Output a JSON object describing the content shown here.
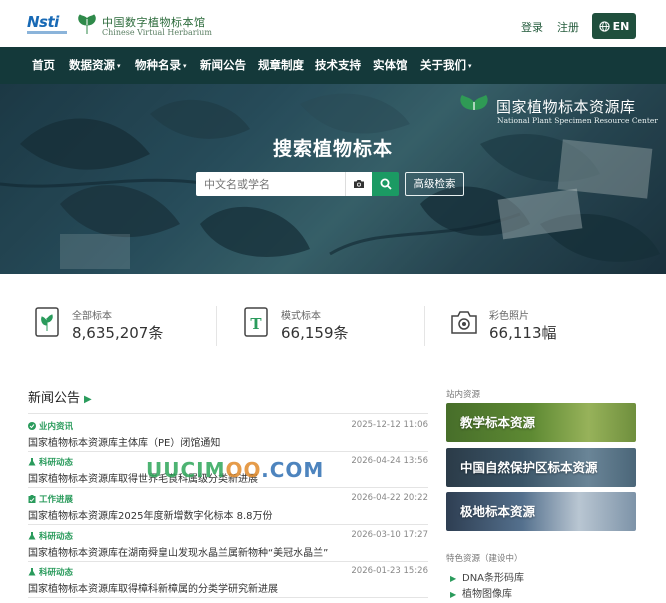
{
  "header": {
    "logo_text": "Nsti",
    "site_name_cn": "中国数字植物标本馆",
    "site_name_en": "Chinese Virtual Herbarium",
    "login": "登录",
    "register": "注册",
    "language": "EN",
    "accent_color": "#1f4f3d"
  },
  "nav": {
    "items": [
      {
        "label": "首页",
        "dropdown": false
      },
      {
        "label": "数据资源",
        "dropdown": true
      },
      {
        "label": "物种名录",
        "dropdown": true
      },
      {
        "label": "新闻公告",
        "dropdown": false
      },
      {
        "label": "规章制度",
        "dropdown": false
      },
      {
        "label": "技术支持",
        "dropdown": false
      },
      {
        "label": "实体馆",
        "dropdown": false
      },
      {
        "label": "关于我们",
        "dropdown": true
      }
    ],
    "caret": "▾",
    "background_color": "#14393a"
  },
  "hero": {
    "brand_cn": "国家植物标本资源库",
    "brand_en": "National Plant Specimen Resource Center",
    "heading": "搜索植物标本",
    "search_placeholder": "中文名或学名",
    "advanced_search": "高级检索",
    "camera_icon": "camera-icon",
    "search_icon": "search-icon"
  },
  "stats": [
    {
      "label": "全部标本",
      "value": "8,635,207条",
      "icon": "specimen-leaf-icon"
    },
    {
      "label": "模式标本",
      "value": "66,159条",
      "icon": "type-specimen-icon"
    },
    {
      "label": "彩色照片",
      "value": "66,113幅",
      "icon": "camera-icon"
    }
  ],
  "news": {
    "title": "新闻公告",
    "arrow": "▶",
    "items": [
      {
        "category": "业内资讯",
        "category_icon": "check-circle-icon",
        "date": "2025-12-12 11:06",
        "headline": "国家植物标本资源库主体库（PE）闭馆通知"
      },
      {
        "category": "科研动态",
        "category_icon": "flask-icon",
        "date": "2026-04-24 13:56",
        "headline": "国家植物标本资源库取得世界毛茛科属级分类新进展"
      },
      {
        "category": "工作进展",
        "category_icon": "clipboard-icon",
        "date": "2026-04-22 20:22",
        "headline": "国家植物标本资源库2025年度新增数字化标本 8.8万份"
      },
      {
        "category": "科研动态",
        "category_icon": "flask-icon",
        "date": "2026-03-10 17:27",
        "headline": "国家植物标本资源库在湖南舜皇山发现水晶兰属新物种“美冠水晶兰”"
      },
      {
        "category": "科研动态",
        "category_icon": "flask-icon",
        "date": "2026-01-23 15:26",
        "headline": "国家植物标本资源库取得樟科新樟属的分类学研究新进展"
      }
    ]
  },
  "watermark": {
    "part1": "UUCIM",
    "part2": "OO",
    "part3": ".COM"
  },
  "sidebar": {
    "internal_heading": "站内资源",
    "cards": [
      {
        "label": "教学标本资源"
      },
      {
        "label": "中国自然保护区标本资源"
      },
      {
        "label": "极地标本资源"
      }
    ],
    "featured_heading": "特色资源（建设中）",
    "featured_items": [
      {
        "label": "DNA条形码库",
        "bullet": "▶"
      },
      {
        "label": "植物图像库",
        "bullet": "▶"
      }
    ]
  }
}
